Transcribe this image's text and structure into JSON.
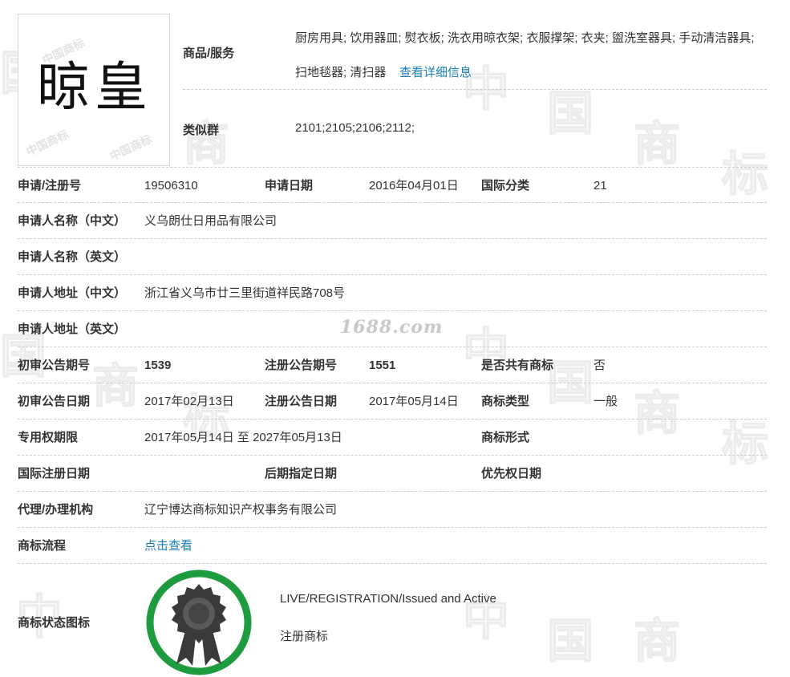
{
  "watermark": {
    "glyphs": [
      "中",
      "国",
      "商",
      "标"
    ],
    "site": "1688.com",
    "logo_marks": [
      "中国商标",
      "中国商标",
      "中国商标"
    ]
  },
  "trademark": {
    "image_text": "晾皇"
  },
  "goods": {
    "label": "商品/服务",
    "value": "厨房用具; 饮用器皿; 熨衣板; 洗衣用晾衣架; 衣服撑架; 衣夹; 盥洗室器具; 手动清洁器具; 扫地毯器; 清扫器",
    "link": "查看详细信息"
  },
  "similar_group": {
    "label": "类似群",
    "value": "2101;2105;2106;2112;"
  },
  "rows": {
    "r1": {
      "l1": "申请/注册号",
      "v1": "19506310",
      "l2": "申请日期",
      "v2": "2016年04月01日",
      "l3": "国际分类",
      "v3": "21"
    },
    "r2": {
      "l1": "申请人名称（中文）",
      "v1": "义乌朗仕日用品有限公司"
    },
    "r3": {
      "l1": "申请人名称（英文）",
      "v1": ""
    },
    "r4": {
      "l1": "申请人地址（中文）",
      "v1": "浙江省义乌市廿三里街道祥民路708号"
    },
    "r5": {
      "l1": "申请人地址（英文）",
      "v1": ""
    },
    "r6": {
      "l1": "初审公告期号",
      "v1": "1539",
      "l2": "注册公告期号",
      "v2": "1551",
      "l3": "是否共有商标",
      "v3": "否"
    },
    "r7": {
      "l1": "初审公告日期",
      "v1": "2017年02月13日",
      "l2": "注册公告日期",
      "v2": "2017年05月14日",
      "l3": "商标类型",
      "v3": "一般"
    },
    "r8": {
      "l1": "专用权期限",
      "v1": "2017年05月14日 至 2027年05月13日",
      "l3": "商标形式",
      "v3": ""
    },
    "r9": {
      "l1": "国际注册日期",
      "v1": "",
      "l2": "后期指定日期",
      "v2": "",
      "l3": "优先权日期",
      "v3": ""
    },
    "r10": {
      "l1": "代理/办理机构",
      "v1": "辽宁博达商标知识产权事务有限公司"
    },
    "r11": {
      "l1": "商标流程",
      "link": "点击查看"
    }
  },
  "status": {
    "label": "商标状态图标",
    "line1": "LIVE/REGISTRATION/Issued and Active",
    "line2": "注册商标",
    "ring_color": "#1e9a3f",
    "badge_color": "#3a3a3a"
  },
  "colors": {
    "link": "#1a7fb8",
    "divider": "#cccccc",
    "label_text": "#333333"
  }
}
